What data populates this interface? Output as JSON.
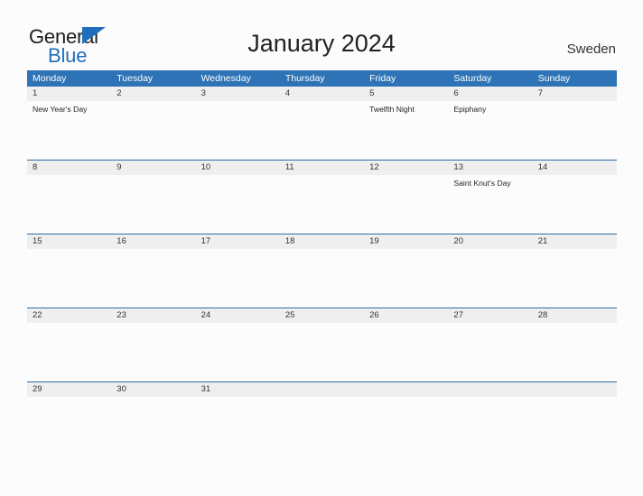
{
  "brand": {
    "name_part1": "General",
    "name_part2": "Blue",
    "flag_icon": "blue-flag-triangle",
    "accent_color": "#1f6fbd"
  },
  "header": {
    "title": "January 2024",
    "region": "Sweden"
  },
  "colors": {
    "weekday_header_bg": "#2e73b5",
    "date_band_bg": "#efefef",
    "week_divider": "#2e6ca4",
    "page_bg": "#fcfcfc",
    "text": "#222222"
  },
  "calendar": {
    "weekdays": [
      "Monday",
      "Tuesday",
      "Wednesday",
      "Thursday",
      "Friday",
      "Saturday",
      "Sunday"
    ],
    "weeks": [
      {
        "days": [
          {
            "date": "1",
            "events": [
              "New Year's Day"
            ]
          },
          {
            "date": "2",
            "events": []
          },
          {
            "date": "3",
            "events": []
          },
          {
            "date": "4",
            "events": []
          },
          {
            "date": "5",
            "events": [
              "Twelfth Night"
            ]
          },
          {
            "date": "6",
            "events": [
              "Epiphany"
            ]
          },
          {
            "date": "7",
            "events": []
          }
        ]
      },
      {
        "days": [
          {
            "date": "8",
            "events": []
          },
          {
            "date": "9",
            "events": []
          },
          {
            "date": "10",
            "events": []
          },
          {
            "date": "11",
            "events": []
          },
          {
            "date": "12",
            "events": []
          },
          {
            "date": "13",
            "events": [
              "Saint Knut's Day"
            ]
          },
          {
            "date": "14",
            "events": []
          }
        ]
      },
      {
        "days": [
          {
            "date": "15",
            "events": []
          },
          {
            "date": "16",
            "events": []
          },
          {
            "date": "17",
            "events": []
          },
          {
            "date": "18",
            "events": []
          },
          {
            "date": "19",
            "events": []
          },
          {
            "date": "20",
            "events": []
          },
          {
            "date": "21",
            "events": []
          }
        ]
      },
      {
        "days": [
          {
            "date": "22",
            "events": []
          },
          {
            "date": "23",
            "events": []
          },
          {
            "date": "24",
            "events": []
          },
          {
            "date": "25",
            "events": []
          },
          {
            "date": "26",
            "events": []
          },
          {
            "date": "27",
            "events": []
          },
          {
            "date": "28",
            "events": []
          }
        ]
      },
      {
        "days": [
          {
            "date": "29",
            "events": []
          },
          {
            "date": "30",
            "events": []
          },
          {
            "date": "31",
            "events": []
          },
          {
            "date": "",
            "events": []
          },
          {
            "date": "",
            "events": []
          },
          {
            "date": "",
            "events": []
          },
          {
            "date": "",
            "events": []
          }
        ]
      }
    ]
  }
}
